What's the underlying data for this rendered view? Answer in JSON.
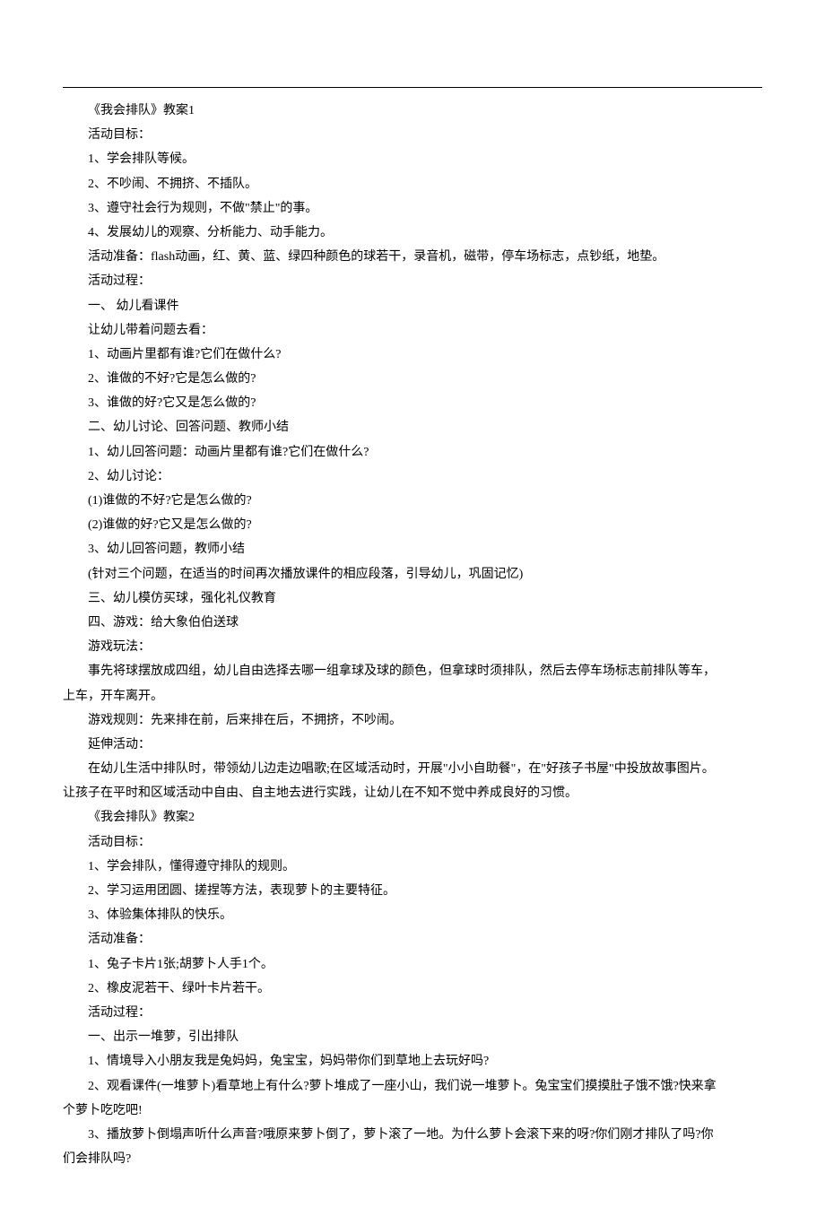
{
  "lines": [
    {
      "text": "《我会排队》教案1",
      "indent": true
    },
    {
      "text": "活动目标：",
      "indent": true
    },
    {
      "text": "1、学会排队等候。",
      "indent": true
    },
    {
      "text": "2、不吵闹、不拥挤、不插队。",
      "indent": true
    },
    {
      "text": "3、遵守社会行为规则，不做\"禁止\"的事。",
      "indent": true
    },
    {
      "text": "4、发展幼儿的观察、分析能力、动手能力。",
      "indent": true
    },
    {
      "text": "活动准备：flash动画，红、黄、蓝、绿四种颜色的球若干，录音机，磁带，停车场标志，点钞纸，地垫。",
      "indent": true
    },
    {
      "text": "活动过程：",
      "indent": true
    },
    {
      "text": "一、 幼儿看课件",
      "indent": true
    },
    {
      "text": "让幼儿带着问题去看：",
      "indent": true
    },
    {
      "text": "1、动画片里都有谁?它们在做什么?",
      "indent": true
    },
    {
      "text": "2、谁做的不好?它是怎么做的?",
      "indent": true
    },
    {
      "text": "3、谁做的好?它又是怎么做的?",
      "indent": true
    },
    {
      "text": "二、幼儿讨论、回答问题、教师小结",
      "indent": true
    },
    {
      "text": "1、幼儿回答问题：动画片里都有谁?它们在做什么?",
      "indent": true
    },
    {
      "text": "2、幼儿讨论：",
      "indent": true
    },
    {
      "text": "(1)谁做的不好?它是怎么做的?",
      "indent": true
    },
    {
      "text": "(2)谁做的好?它又是怎么做的?",
      "indent": true
    },
    {
      "text": "3、幼儿回答问题，教师小结",
      "indent": true
    },
    {
      "text": "(针对三个问题，在适当的时间再次播放课件的相应段落，引导幼儿，巩固记忆)",
      "indent": true
    },
    {
      "text": "三、幼儿模仿买球，强化礼仪教育",
      "indent": true
    },
    {
      "text": "四、游戏：给大象伯伯送球",
      "indent": true
    },
    {
      "text": "游戏玩法：",
      "indent": true
    },
    {
      "text": "事先将球摆放成四组，幼儿自由选择去哪一组拿球及球的颜色，但拿球时须排队，然后去停车场标志前排队等车，",
      "indent": true
    },
    {
      "text": "上车，开车离开。",
      "indent": false
    },
    {
      "text": "游戏规则：先来排在前，后来排在后，不拥挤，不吵闹。",
      "indent": true
    },
    {
      "text": "延伸活动：",
      "indent": true
    },
    {
      "text": "在幼儿生活中排队时，带领幼儿边走边唱歌;在区域活动时，开展\"小小自助餐\"，在\"好孩子书屋\"中投放故事图片。",
      "indent": true
    },
    {
      "text": "让孩子在平时和区域活动中自由、自主地去进行实践，让幼儿在不知不觉中养成良好的习惯。",
      "indent": false
    },
    {
      "text": "《我会排队》教案2",
      "indent": true
    },
    {
      "text": "活动目标：",
      "indent": true
    },
    {
      "text": "1、学会排队，懂得遵守排队的规则。",
      "indent": true
    },
    {
      "text": "2、学习运用团圆、搓捏等方法，表现萝卜的主要特征。",
      "indent": true
    },
    {
      "text": "3、体验集体排队的快乐。",
      "indent": true
    },
    {
      "text": "活动准备：",
      "indent": true
    },
    {
      "text": "1、兔子卡片1张;胡萝卜人手1个。",
      "indent": true
    },
    {
      "text": "2、橡皮泥若干、绿叶卡片若干。",
      "indent": true
    },
    {
      "text": "活动过程：",
      "indent": true
    },
    {
      "text": "一、出示一堆萝，引出排队",
      "indent": true
    },
    {
      "text": "1、情境导入小朋友我是兔妈妈，兔宝宝，妈妈带你们到草地上去玩好吗?",
      "indent": true
    },
    {
      "text": "2、观看课件(一堆萝卜)看草地上有什么?萝卜堆成了一座小山，我们说一堆萝卜。兔宝宝们摸摸肚子饿不饿?快来拿",
      "indent": true
    },
    {
      "text": "个萝卜吃吃吧!",
      "indent": false
    },
    {
      "text": "3、播放萝卜倒塌声听什么声音?哦原来萝卜倒了，萝卜滚了一地。为什么萝卜会滚下来的呀?你们刚才排队了吗?你",
      "indent": true
    },
    {
      "text": "们会排队吗?",
      "indent": false
    }
  ]
}
